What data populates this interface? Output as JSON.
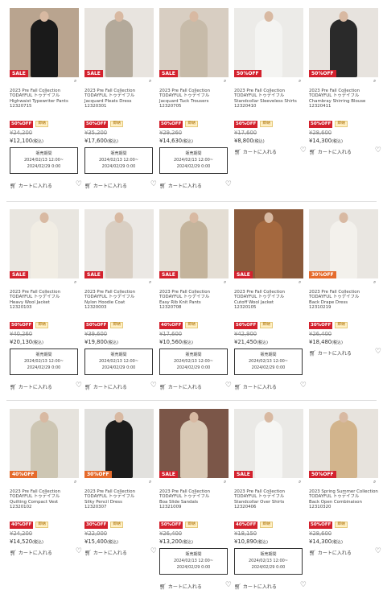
{
  "rows": [
    {
      "items": [
        {
          "collection": "2023 Pre Fall Collection",
          "brand": "TODAYFUL トゥデイフル",
          "title": "Highwaist Typewriter Pants",
          "sku": "12320715",
          "badge": "SALE",
          "badge_color": "#d3212d",
          "off": "50%OFF",
          "stock": "即納",
          "price_old": "¥24,200",
          "price_new": "¥12,100",
          "tax": "(税込)",
          "has_period": true,
          "img_bg": "#b9a48f",
          "fig_color": "#1a1a1a"
        },
        {
          "collection": "2023 Pre Fall Collection",
          "brand": "TODAYFUL トゥデイフル",
          "title": "Jacquard Pleats Dress",
          "sku": "12320301",
          "badge": "SALE",
          "badge_color": "#d3212d",
          "off": "50%OFF",
          "stock": "即納",
          "price_old": "¥35,200",
          "price_new": "¥17,600",
          "tax": "(税込)",
          "has_period": true,
          "img_bg": "#e8e4df",
          "fig_color": "#b3a99a"
        },
        {
          "collection": "2023 Pre Fall Collection",
          "brand": "TODAYFUL トゥデイフル",
          "title": "Jacquard Tuck Trousers",
          "sku": "12320705",
          "badge": "SALE",
          "badge_color": "#d3212d",
          "off": "50%OFF",
          "stock": "即納",
          "price_old": "¥29,260",
          "price_new": "¥14,630",
          "tax": "(税込)",
          "has_period": true,
          "img_bg": "#d8cec2",
          "fig_color": "#c7bba9"
        },
        {
          "collection": "2023 Pre Fall Collection",
          "brand": "TODAYFUL トゥデイフル",
          "title": "Standcollar Sleeveless Shirts",
          "sku": "12320410",
          "badge": "50%OFF",
          "badge_color": "#d3212d",
          "off": "50%OFF",
          "stock": "即納",
          "price_old": "¥17,600",
          "price_new": "¥8,800",
          "tax": "(税込)",
          "has_period": false,
          "img_bg": "#ecebe8",
          "fig_color": "#f4f4f2"
        },
        {
          "collection": "2023 Pre Fall Collection",
          "brand": "TODAYFUL トゥデイフル",
          "title": "Chambray Shirring Blouse",
          "sku": "12320411",
          "badge": "50%OFF",
          "badge_color": "#d3212d",
          "off": "50%OFF",
          "stock": "即納",
          "price_old": "¥28,600",
          "price_new": "¥14,300",
          "tax": "(税込)",
          "has_period": false,
          "img_bg": "#e7e3de",
          "fig_color": "#2a2a2a"
        }
      ]
    },
    {
      "items": [
        {
          "collection": "2023 Pre Fall Collection",
          "brand": "TODAYFUL トゥデイフル",
          "title": "Heavy Wool Jacket",
          "sku": "12320103",
          "badge": "SALE",
          "badge_color": "#d3212d",
          "off": "50%OFF",
          "stock": "即納",
          "price_old": "¥40,260",
          "price_new": "¥20,130",
          "tax": "(税込)",
          "has_period": true,
          "img_bg": "#e9e6e0",
          "fig_color": "#f1ede4"
        },
        {
          "collection": "2023 Pre Fall Collection",
          "brand": "TODAYFUL トゥデイフル",
          "title": "Nylon Hoodie Coat",
          "sku": "12320003",
          "badge": "SALE",
          "badge_color": "#d3212d",
          "off": "50%OFF",
          "stock": "即納",
          "price_old": "¥39,600",
          "price_new": "¥19,800",
          "tax": "(税込)",
          "has_period": true,
          "img_bg": "#ebe8e4",
          "fig_color": "#d9cfc3"
        },
        {
          "collection": "2023 Pre Fall Collection",
          "brand": "TODAYFUL トゥデイフル",
          "title": "Easy Rib Knit Pants",
          "sku": "12320708",
          "badge": "SALE",
          "badge_color": "#d3212d",
          "off": "40%OFF",
          "stock": "即納",
          "price_old": "¥17,600",
          "price_new": "¥10,560",
          "tax": "(税込)",
          "has_period": true,
          "img_bg": "#e4ded4",
          "fig_color": "#c4b49c"
        },
        {
          "collection": "2023 Pre Fall Collection",
          "brand": "TODAYFUL トゥデイフル",
          "title": "Cutoff Wool Jacket",
          "sku": "12320105",
          "badge": "SALE",
          "badge_color": "#d3212d",
          "off": "50%OFF",
          "stock": "即納",
          "price_old": "¥42,900",
          "price_new": "¥21,450",
          "tax": "(税込)",
          "has_period": true,
          "img_bg": "#8a5a3b",
          "fig_color": "#a4683e"
        },
        {
          "collection": "2023 Pre Fall Collection",
          "brand": "TODAYFUL トゥデイフル",
          "title": "Back Drape Dress",
          "sku": "12310219",
          "badge": "30%OFF",
          "badge_color": "#e56b2c",
          "off": "30%OFF",
          "stock": "即納",
          "price_old": "¥26,400",
          "price_new": "¥18,480",
          "tax": "(税込)",
          "has_period": false,
          "img_bg": "#e9e6e1",
          "fig_color": "#f3f1ec"
        }
      ]
    },
    {
      "items": [
        {
          "collection": "2023 Pre Fall Collection",
          "brand": "TODAYFUL トゥデイフル",
          "title": "Quilting Compact Vest",
          "sku": "12320102",
          "badge": "40%OFF",
          "badge_color": "#e56b2c",
          "off": "40%OFF",
          "stock": "即納",
          "price_old": "¥24,200",
          "price_new": "¥14,520",
          "tax": "(税込)",
          "has_period": false,
          "img_bg": "#e6e3dd",
          "fig_color": "#cdc6b3"
        },
        {
          "collection": "2023 Pre Fall Collection",
          "brand": "TODAYFUL トゥデイフル",
          "title": "Silky Pencil Dress",
          "sku": "12320307",
          "badge": "30%OFF",
          "badge_color": "#e56b2c",
          "off": "30%OFF",
          "stock": "即納",
          "price_old": "¥22,000",
          "price_new": "¥15,400",
          "tax": "(税込)",
          "has_period": false,
          "img_bg": "#e2e1de",
          "fig_color": "#1c1c1c"
        },
        {
          "collection": "2023 Pre Fall Collection",
          "brand": "TODAYFUL トゥデイフル",
          "title": "Boa Slide Sandals",
          "sku": "12321009",
          "badge": "SALE",
          "badge_color": "#d3212d",
          "off": "50%OFF",
          "stock": "即納",
          "price_old": "¥26,400",
          "price_new": "¥13,200",
          "tax": "(税込)",
          "has_period": true,
          "img_bg": "#7b5648",
          "fig_color": "#d8c8b4"
        },
        {
          "collection": "2023 Pre Fall Collection",
          "brand": "TODAYFUL トゥデイフル",
          "title": "Standcollar Over Shirts",
          "sku": "12320406",
          "badge": "SALE",
          "badge_color": "#d3212d",
          "off": "40%OFF",
          "stock": "即納",
          "price_old": "¥18,150",
          "price_new": "¥10,890",
          "tax": "(税込)",
          "has_period": true,
          "img_bg": "#eae9e6",
          "fig_color": "#f6f6f4"
        },
        {
          "collection": "2023 Spring Summer Collection",
          "brand": "TODAYFUL トゥデイフル",
          "title": "Back Open Combinaison",
          "sku": "12310320",
          "badge": "50%OFF",
          "badge_color": "#d3212d",
          "off": "50%OFF",
          "stock": "即納",
          "price_old": "¥28,600",
          "price_new": "¥14,300",
          "tax": "(税込)",
          "has_period": false,
          "img_bg": "#e7e3dd",
          "fig_color": "#d2b48c"
        }
      ]
    }
  ],
  "period": {
    "label": "販売期間",
    "start": "2024/02/13 12:00~",
    "end": "2024/02/29 0:00"
  },
  "cart_label": "カートに入れる"
}
